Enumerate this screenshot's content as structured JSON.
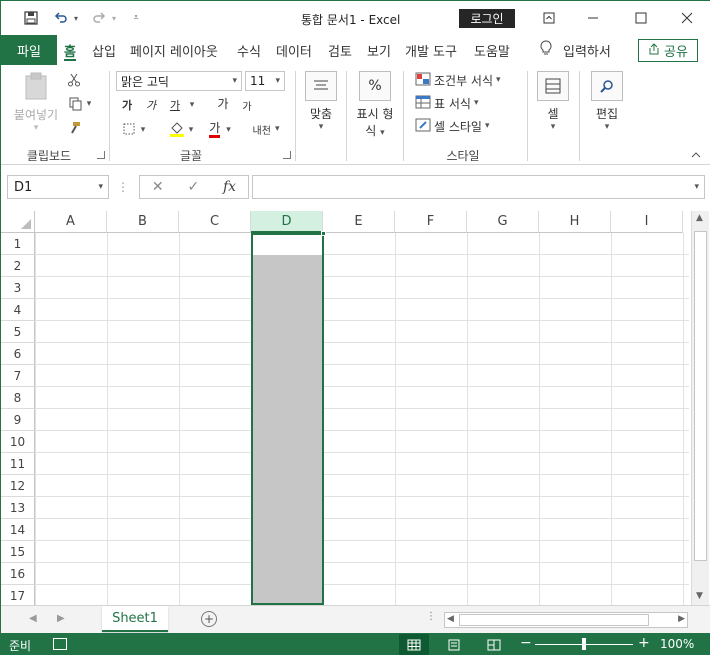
{
  "app": {
    "title": "통합 문서1 - Excel",
    "login_label": "로그인"
  },
  "quick_access": {
    "save_icon": "save-icon",
    "undo_icon": "undo-icon",
    "redo_icon": "redo-icon",
    "customize_icon": "customize-icon"
  },
  "ribbon_tabs": {
    "file": "파일",
    "items": [
      "홈",
      "삽입",
      "페이지 레이아웃",
      "수식",
      "데이터",
      "검토",
      "보기",
      "개발 도구",
      "도움말"
    ],
    "active": "홈",
    "tell_me": "입력하서",
    "share": "공유"
  },
  "clipboard": {
    "paste_label": "붙여넣기",
    "group_label": "클립보드"
  },
  "font": {
    "name": "맑은 고딕",
    "size": "11",
    "bold": "가",
    "italic": "가",
    "underline": "가",
    "grow": "가",
    "shrink": "가",
    "font_color": "가",
    "phonetic": "내천",
    "group_label": "글꼴"
  },
  "alignment": {
    "label": "맞춤"
  },
  "number": {
    "label_1": "표시 형",
    "label_2": "식",
    "symbol": "%"
  },
  "styles": {
    "conditional": "조건부 서식",
    "table": "표 서식",
    "cell_style": "셀 스타일",
    "group_label": "스타일"
  },
  "cells": {
    "label": "셀"
  },
  "editing": {
    "label": "편집"
  },
  "formula_bar": {
    "name_box": "D1",
    "fx": "fx",
    "value": ""
  },
  "columns": [
    "A",
    "B",
    "C",
    "D",
    "E",
    "F",
    "G",
    "H",
    "I"
  ],
  "selected_column": "D",
  "rows": [
    "1",
    "2",
    "3",
    "4",
    "5",
    "6",
    "7",
    "8",
    "9",
    "10",
    "11",
    "12",
    "13",
    "14",
    "15",
    "16",
    "17"
  ],
  "sheets": [
    "Sheet1"
  ],
  "active_sheet": "Sheet1",
  "status": {
    "ready": "준비",
    "zoom": "100%"
  },
  "colors": {
    "accent": "#217346",
    "selection_fill": "#c6c6c6"
  }
}
